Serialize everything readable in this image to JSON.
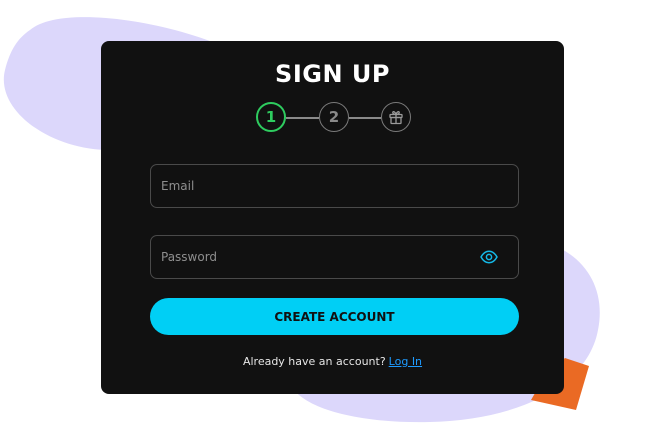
{
  "title": "SIGN UP",
  "stepper": {
    "steps": [
      "1",
      "2"
    ],
    "final_step_icon": "gift-icon",
    "active_step": 1
  },
  "form": {
    "email_placeholder": "Email",
    "password_placeholder": "Password",
    "password_toggle_icon": "eye-icon",
    "submit_label": "CREATE ACCOUNT"
  },
  "footer": {
    "prompt": "Already have an account?",
    "link_label": "Log In"
  },
  "colors": {
    "card_bg": "#111111",
    "accent": "#00cff5",
    "step_active": "#2ecc5f",
    "link": "#1e9bff",
    "blob": "#dcd7fb",
    "deco": "#ea6a24"
  }
}
